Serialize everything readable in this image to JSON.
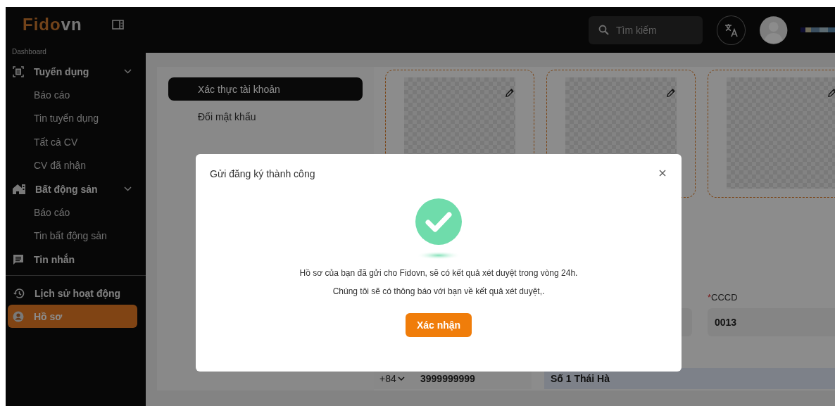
{
  "logo": {
    "brand": "Fido",
    "suffix": "vn"
  },
  "sidebar": {
    "sections": [
      {
        "label": "Dashboard",
        "items": [
          {
            "label": "Tuyển dụng",
            "kind": "group",
            "expanded": true,
            "selected": false,
            "children": [
              {
                "label": "Báo cáo",
                "selected": false
              },
              {
                "label": "Tin tuyển dụng",
                "selected": false
              },
              {
                "label": "Tất cả CV",
                "selected": false
              },
              {
                "label": "CV đã nhận",
                "selected": false
              }
            ]
          },
          {
            "label": "Bất động sản",
            "kind": "group",
            "expanded": true,
            "selected": false,
            "children": [
              {
                "label": "Báo cáo",
                "selected": false
              },
              {
                "label": "Tin bất động sản",
                "selected": false
              }
            ]
          },
          {
            "label": "Tin nhắn",
            "kind": "link",
            "selected": false
          }
        ]
      },
      {
        "items": [
          {
            "label": "Lịch sử hoạt động",
            "kind": "link",
            "selected": false
          },
          {
            "label": "Hồ sơ",
            "kind": "link",
            "selected": true
          }
        ]
      }
    ]
  },
  "topbar": {
    "search": {
      "placeholder": "Tìm kiếm"
    }
  },
  "settings_menu": [
    {
      "label": "Xác thực tài khoản",
      "selected": true
    },
    {
      "label": "Đổi mật khẩu",
      "selected": false
    }
  ],
  "photo_cards": [
    {
      "kind": "portrait"
    },
    {
      "kind": "portrait"
    },
    {
      "kind": "portrait"
    }
  ],
  "form": {
    "cccd": {
      "label": "CCCD",
      "required_mark": "*",
      "value": "0013"
    },
    "phone": {
      "prefix": "+84",
      "value": "3999999999"
    },
    "address": {
      "value": "Số 1 Thái Hà"
    }
  },
  "modal": {
    "title": "Gửi đăng ký thành công",
    "messages": [
      "Hồ sơ của bạn đã gửi cho Fidovn, sẽ có kết quả xét duyệt trong vòng 24h.",
      "Chúng tôi sẽ có thông báo với bạn về kết quả xét duyệt,."
    ],
    "button": "Xác nhận"
  }
}
